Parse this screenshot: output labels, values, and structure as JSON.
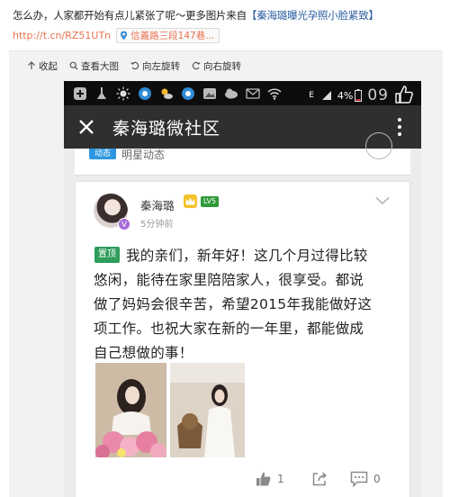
{
  "post": {
    "text": "怎么办，人家都开始有点儿紧张了呢～更多图片来自",
    "topic": "【秦海璐曝光孕照小脸紧致】",
    "short_link": "http://t.cn/RZ51UTn",
    "location": "信義路三段147巷..."
  },
  "viewer_tools": {
    "collapse": "收起",
    "view_large": "查看大图",
    "rotate_left": "向左旋转",
    "rotate_right": "向右旋转"
  },
  "statusbar": {
    "network": "E",
    "battery": "4%",
    "time": "09"
  },
  "app": {
    "title": "秦海璐微社区"
  },
  "prev_card": {
    "badge": "动态",
    "label": "明星动态"
  },
  "card": {
    "username": "秦海璐",
    "level": "LV5",
    "time": "5分钟前",
    "verified": "V",
    "pinned_label": "置顶",
    "lines": [
      "我的亲们，新年好！这几个月过得比较",
      "悠闲，能待在家里陪陪家人，很享受。都说",
      "做了妈妈会很辛苦，希望2015年我能做好这",
      "项工作。也祝大家在新的一年里，都能做成",
      "自己想做的事！"
    ],
    "like_count": "1",
    "comment_count": "0"
  },
  "icons": {
    "pin": "location-pin-icon",
    "like": "thumbs-up-icon",
    "share": "share-icon",
    "comment": "comment-icon",
    "close": "close-icon",
    "more": "more-vertical-icon"
  },
  "colors": {
    "link_orange": "#eb7350",
    "topic_blue": "#2a5d9f",
    "appbar": "#2f2f2f",
    "pinned_green": "#2d9d5a",
    "level_green": "#2e9a39"
  }
}
